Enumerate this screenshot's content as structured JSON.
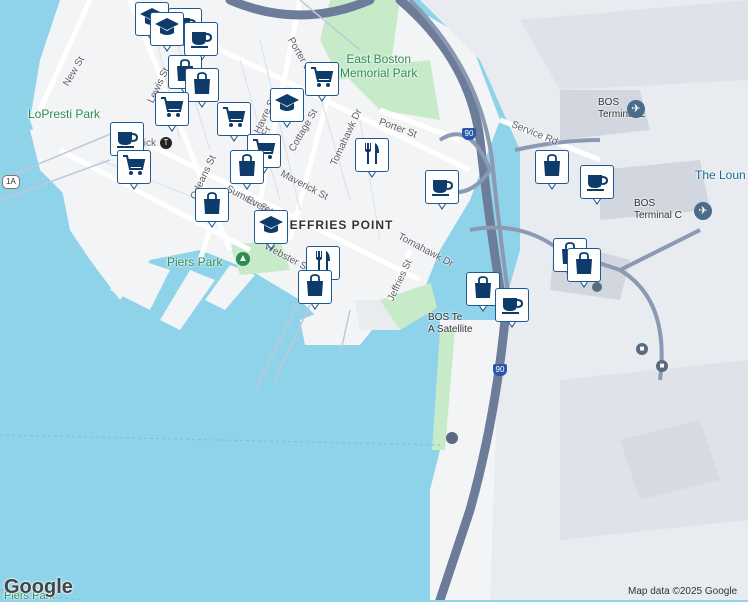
{
  "map": {
    "place_labels": {
      "east_boston_memorial_park": "East Boston\nMemorial Park",
      "lopresti_park": "LoPresti Park",
      "jeffries_point": "JEFFRIES POINT",
      "piers_park": "Piers Park",
      "piers_park_bottom": "Piers Park",
      "bos_terminal_e": "BOS\nTerminal E",
      "bos_terminal_c": "BOS\nTerminal C",
      "the_lounge": "The Loun",
      "bos_terminal_a": "BOS Te\nA Satellite"
    },
    "street_labels": {
      "new_st": "New St",
      "porter_st_top": "Porter St",
      "porter_st": "Porter St",
      "cottage_st": "Cottage St",
      "tomahawk_dr_1": "Tomahawk Dr",
      "tomahawk_dr_2": "Tomahawk Dr",
      "maverick_st": "Maverick St",
      "orleans_st": "Orleans St",
      "webster_st": "Webster St",
      "jeffries_st": "Jeffries St",
      "service_rd": "Service Rd",
      "sumner_st": "Sumner St",
      "everett_st": "Everett St",
      "havre_st": "Havre St",
      "frankfort": "Fr",
      "lewis_st": "Lewis St",
      "maverick_station": "Maverick"
    },
    "route_shields": {
      "i90_top": "90",
      "i90_bottom": "90",
      "route_1a": "1A"
    },
    "markers": [
      {
        "icon": "graduation-cap-icon",
        "kind": "school"
      },
      {
        "icon": "coffee-cup-icon",
        "kind": "cafe"
      },
      {
        "icon": "graduation-cap-icon",
        "kind": "school"
      },
      {
        "icon": "coffee-cup-icon",
        "kind": "cafe"
      },
      {
        "icon": "shopping-bag-icon",
        "kind": "shop"
      },
      {
        "icon": "shopping-cart-icon",
        "kind": "grocery"
      },
      {
        "icon": "shopping-bag-icon",
        "kind": "shop"
      },
      {
        "icon": "shopping-cart-icon",
        "kind": "grocery"
      },
      {
        "icon": "graduation-cap-icon",
        "kind": "school"
      },
      {
        "icon": "coffee-cup-icon",
        "kind": "cafe"
      },
      {
        "icon": "shopping-cart-icon",
        "kind": "grocery"
      },
      {
        "icon": "shopping-cart-icon",
        "kind": "grocery"
      },
      {
        "icon": "fork-knife-icon",
        "kind": "restaurant"
      },
      {
        "icon": "shopping-bag-icon",
        "kind": "shop"
      },
      {
        "icon": "shopping-cart-icon",
        "kind": "grocery"
      },
      {
        "icon": "shopping-bag-icon",
        "kind": "shop"
      },
      {
        "icon": "coffee-cup-icon",
        "kind": "cafe"
      },
      {
        "icon": "graduation-cap-icon",
        "kind": "school"
      },
      {
        "icon": "fork-knife-icon",
        "kind": "restaurant"
      },
      {
        "icon": "shopping-bag-icon",
        "kind": "shop"
      },
      {
        "icon": "shopping-bag-icon",
        "kind": "shop"
      },
      {
        "icon": "coffee-cup-icon",
        "kind": "cafe"
      },
      {
        "icon": "shopping-bag-icon",
        "kind": "shop"
      },
      {
        "icon": "coffee-cup-icon",
        "kind": "cafe"
      },
      {
        "icon": "shopping-bag-icon",
        "kind": "shop"
      },
      {
        "icon": "shopping-bag-icon",
        "kind": "shop"
      }
    ],
    "colors": {
      "water": "#8fd3ea",
      "land": "#f3f4f6",
      "park": "#c7ebc9",
      "airport": "#e8ebf0",
      "highway": "#6d7c99",
      "marker_border": "#1e5a91",
      "marker_icon": "#0d3c6b",
      "label_blue": "#1a6b8f",
      "park_label": "#2e8b57"
    }
  },
  "footer": {
    "logo": "Google",
    "attribution": "Map data ©2025 Google"
  }
}
